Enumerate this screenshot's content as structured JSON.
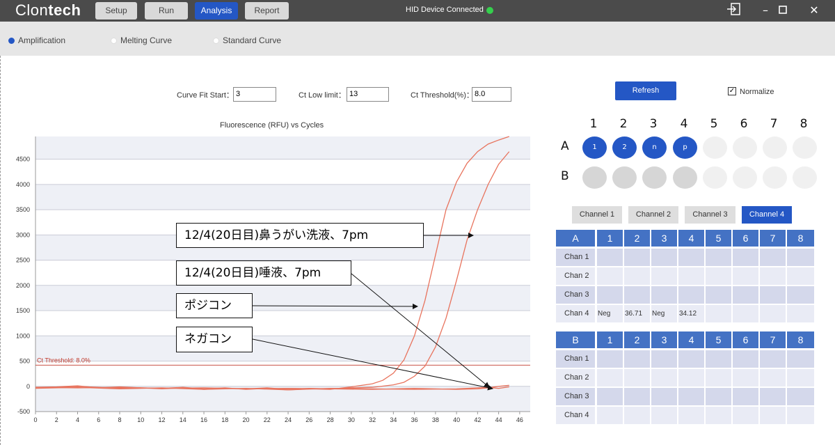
{
  "app": {
    "logo_light": "Clon",
    "logo_bold": "tech",
    "tabs": [
      "Setup",
      "Run",
      "Analysis",
      "Report"
    ],
    "active_tab": "Analysis",
    "device_status": "HID Device Connected",
    "status_color": "#35d04d",
    "accent": "#2457c5"
  },
  "modes": {
    "items": [
      "Amplification",
      "Melting Curve",
      "Standard Curve"
    ],
    "selected": "Amplification"
  },
  "params": {
    "curve_fit_label": "Curve Fit Start：",
    "curve_fit_value": "3",
    "ct_low_label": "Ct Low limit：",
    "ct_low_value": "13",
    "ct_thr_label": "Ct Threshold(%)：",
    "ct_thr_value": "8.0"
  },
  "refresh_label": "Refresh",
  "normalize": {
    "label": "Normalize",
    "checked": true
  },
  "chart_data": {
    "type": "line",
    "title": "Fluorescence (RFU) vs Cycles",
    "xlabel": "",
    "ylabel": "",
    "xlim": [
      0,
      47
    ],
    "ylim": [
      -500,
      4950
    ],
    "x_ticks": [
      0,
      2,
      4,
      6,
      8,
      10,
      12,
      14,
      16,
      18,
      20,
      22,
      24,
      26,
      28,
      30,
      32,
      34,
      36,
      38,
      40,
      42,
      44,
      46
    ],
    "y_ticks": [
      -500,
      0,
      500,
      1000,
      1500,
      2000,
      2500,
      3000,
      3500,
      4000,
      4500
    ],
    "grid": "horizontal bands",
    "threshold": {
      "value": 420,
      "label": "Ct Threshold: 8.0%",
      "color": "#c0392b"
    },
    "series_color": "#e8735d",
    "series": [
      {
        "x": [
          0,
          2,
          4,
          6,
          8,
          10,
          12,
          14,
          16,
          18,
          20,
          22,
          24,
          26,
          28,
          30,
          32,
          33,
          34,
          35,
          36,
          37,
          38,
          39,
          40,
          41,
          42,
          43,
          44,
          45
        ],
        "y": [
          -20,
          -10,
          10,
          -30,
          -10,
          -30,
          -40,
          -20,
          -50,
          -30,
          -60,
          -40,
          -70,
          -50,
          -60,
          -10,
          50,
          120,
          260,
          520,
          1000,
          1700,
          2600,
          3500,
          4050,
          4420,
          4650,
          4800,
          4880,
          4950
        ]
      },
      {
        "x": [
          0,
          2,
          4,
          6,
          8,
          10,
          12,
          14,
          16,
          18,
          20,
          22,
          24,
          26,
          28,
          30,
          32,
          34,
          35,
          36,
          37,
          38,
          39,
          40,
          41,
          42,
          43,
          44,
          45
        ],
        "y": [
          -30,
          -20,
          0,
          -20,
          -40,
          -30,
          -50,
          -30,
          -60,
          -40,
          -50,
          -30,
          -60,
          -40,
          -50,
          -30,
          -20,
          30,
          80,
          200,
          400,
          780,
          1350,
          2100,
          2900,
          3500,
          4000,
          4400,
          4650
        ]
      },
      {
        "x": [
          0,
          4,
          8,
          12,
          16,
          20,
          24,
          28,
          32,
          36,
          40,
          42,
          43,
          44,
          45
        ],
        "y": [
          -20,
          -30,
          -20,
          -40,
          -30,
          -50,
          -40,
          -50,
          -60,
          -40,
          -60,
          -50,
          -30,
          0,
          20
        ]
      },
      {
        "x": [
          0,
          4,
          8,
          12,
          16,
          20,
          24,
          28,
          32,
          36,
          40,
          42,
          43,
          44,
          45
        ],
        "y": [
          -40,
          -20,
          -50,
          -30,
          -60,
          -40,
          -70,
          -40,
          -50,
          -60,
          -50,
          -30,
          -20,
          -40,
          -10
        ]
      }
    ]
  },
  "annotations": [
    {
      "text": "12/4(20日目)鼻うがい洗液、7pm"
    },
    {
      "text": "12/4(20日目)唾液、7pm"
    },
    {
      "text": "ポジコン"
    },
    {
      "text": "ネガコン"
    }
  ],
  "plate": {
    "columns": [
      "1",
      "2",
      "3",
      "4",
      "5",
      "6",
      "7",
      "8"
    ],
    "rows": [
      "A",
      "B"
    ],
    "a_labels": [
      "1",
      "2",
      "n",
      "p"
    ],
    "filled_color": "#2457c5",
    "gray_color": "#d6d6d6",
    "empty_color": "#f0f0f0"
  },
  "channel_tabs": [
    "Channel 1",
    "Channel 2",
    "Channel 3",
    "Channel 4"
  ],
  "active_channel": "Channel 4",
  "ct_tables": [
    {
      "header": "A",
      "columns": [
        "1",
        "2",
        "3",
        "4",
        "5",
        "6",
        "7",
        "8"
      ],
      "rows": [
        {
          "label": "Chan 1",
          "cells": [
            "",
            "",
            "",
            "",
            "",
            "",
            "",
            ""
          ]
        },
        {
          "label": "Chan 2",
          "cells": [
            "",
            "",
            "",
            "",
            "",
            "",
            "",
            ""
          ]
        },
        {
          "label": "Chan 3",
          "cells": [
            "",
            "",
            "",
            "",
            "",
            "",
            "",
            ""
          ]
        },
        {
          "label": "Chan 4",
          "cells": [
            "Neg",
            "36.71",
            "Neg",
            "34.12",
            "",
            "",
            "",
            ""
          ]
        }
      ]
    },
    {
      "header": "B",
      "columns": [
        "1",
        "2",
        "3",
        "4",
        "5",
        "6",
        "7",
        "8"
      ],
      "rows": [
        {
          "label": "Chan 1",
          "cells": [
            "",
            "",
            "",
            "",
            "",
            "",
            "",
            ""
          ]
        },
        {
          "label": "Chan 2",
          "cells": [
            "",
            "",
            "",
            "",
            "",
            "",
            "",
            ""
          ]
        },
        {
          "label": "Chan 3",
          "cells": [
            "",
            "",
            "",
            "",
            "",
            "",
            "",
            ""
          ]
        },
        {
          "label": "Chan 4",
          "cells": [
            "",
            "",
            "",
            "",
            "",
            "",
            "",
            ""
          ]
        }
      ]
    }
  ]
}
